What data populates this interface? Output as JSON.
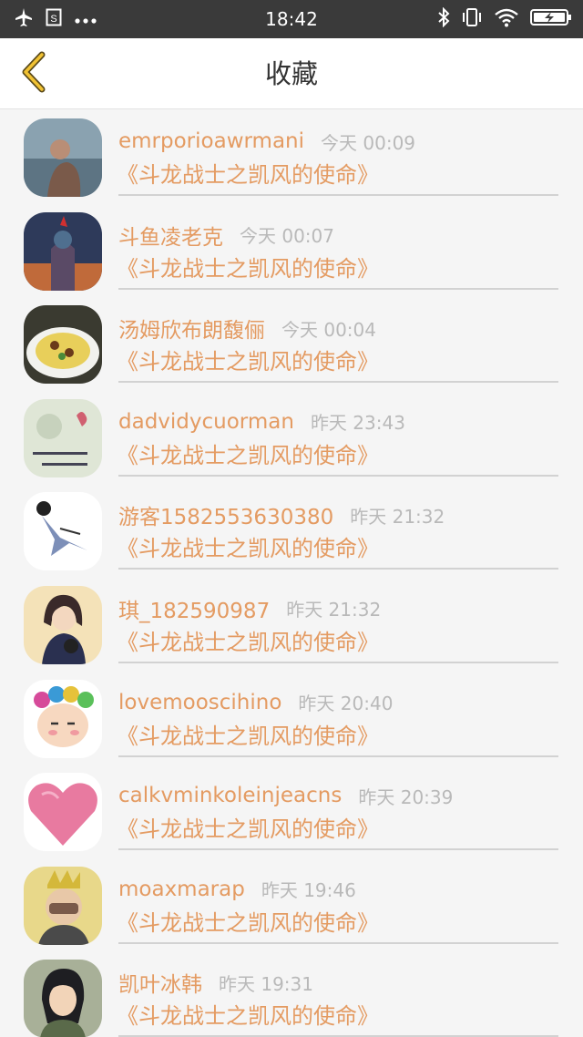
{
  "status_bar": {
    "time": "18:42",
    "left_icons": [
      "airplane-icon",
      "sim-card-icon",
      "more-dots-icon"
    ],
    "right_icons": [
      "bluetooth-icon",
      "vibrate-icon",
      "wifi-icon",
      "battery-charging-icon"
    ]
  },
  "header": {
    "title": "收藏",
    "back_icon": "chevron-left-icon",
    "accent_color": "#e49b62"
  },
  "favorites": [
    {
      "username": "emrporioawrmani",
      "time": "今天 00:09",
      "subject": "《斗龙战士之凯风的使命》"
    },
    {
      "username": "斗鱼凌老克",
      "time": "今天 00:07",
      "subject": "《斗龙战士之凯风的使命》"
    },
    {
      "username": "汤姆欣布朗馥俪",
      "time": "今天 00:04",
      "subject": "《斗龙战士之凯风的使命》"
    },
    {
      "username": "dadvidycuorman",
      "time": "昨天 23:43",
      "subject": "《斗龙战士之凯风的使命》"
    },
    {
      "username": "游客1582553630380",
      "time": "昨天 21:32",
      "subject": "《斗龙战士之凯风的使命》"
    },
    {
      "username": "琪_182590987",
      "time": "昨天 21:32",
      "subject": "《斗龙战士之凯风的使命》"
    },
    {
      "username": "lovemooscihino",
      "time": "昨天 20:40",
      "subject": "《斗龙战士之凯风的使命》"
    },
    {
      "username": "calkvminkoleinjeacns",
      "time": "昨天 20:39",
      "subject": "《斗龙战士之凯风的使命》"
    },
    {
      "username": "moaxmarap",
      "time": "昨天 19:46",
      "subject": "《斗龙战士之凯风的使命》"
    },
    {
      "username": "凯叶冰韩",
      "time": "昨天 19:31",
      "subject": "《斗龙战士之凯风的使命》"
    }
  ]
}
